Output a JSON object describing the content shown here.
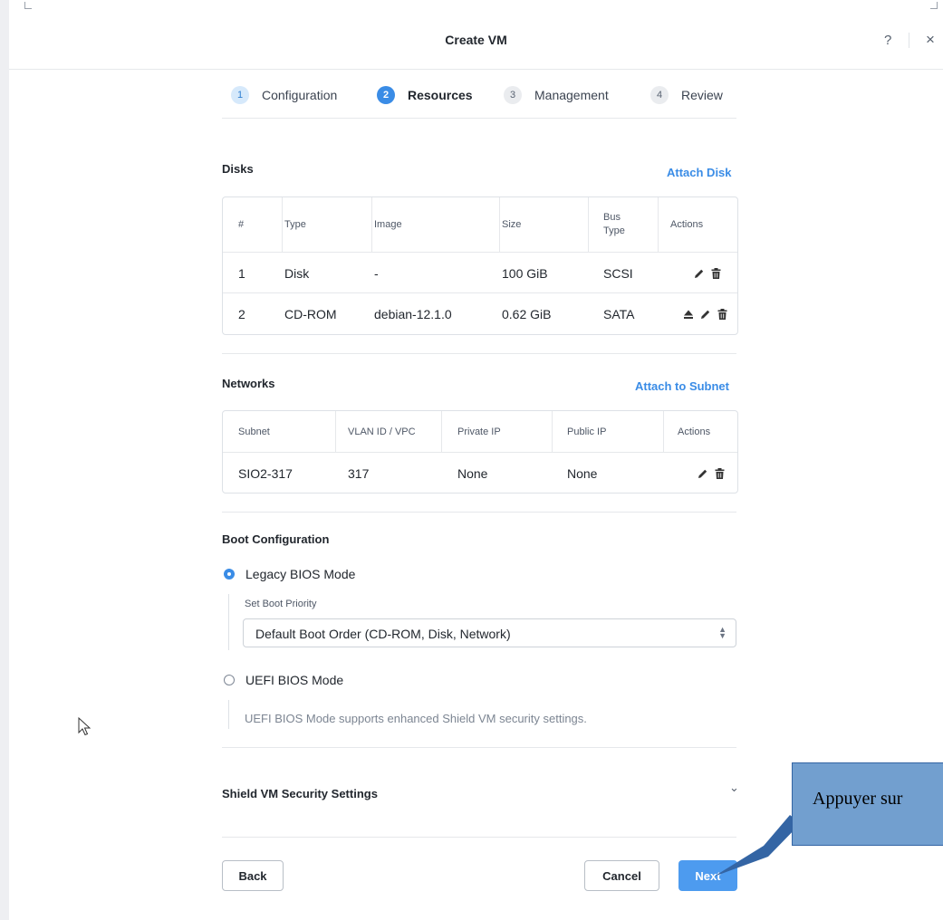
{
  "header": {
    "title": "Create VM",
    "help": "?",
    "close": "×"
  },
  "steps": [
    {
      "num": "1",
      "label": "Configuration",
      "state": "done"
    },
    {
      "num": "2",
      "label": "Resources",
      "state": "active"
    },
    {
      "num": "3",
      "label": "Management",
      "state": "pending"
    },
    {
      "num": "4",
      "label": "Review",
      "state": "pending"
    }
  ],
  "disks": {
    "title": "Disks",
    "action": "Attach Disk",
    "columns": [
      "#",
      "Type",
      "Image",
      "Size",
      "Bus\nType",
      "Actions"
    ],
    "rows": [
      {
        "num": "1",
        "type": "Disk",
        "image": "-",
        "size": "100 GiB",
        "bus": "SCSI",
        "actions": [
          "edit-icon",
          "delete-icon"
        ]
      },
      {
        "num": "2",
        "type": "CD-ROM",
        "image": "debian-12.1.0",
        "size": "0.62 GiB",
        "bus": "SATA",
        "actions": [
          "eject-icon",
          "edit-icon",
          "delete-icon"
        ]
      }
    ]
  },
  "networks": {
    "title": "Networks",
    "action": "Attach to Subnet",
    "columns": [
      "Subnet",
      "VLAN ID / VPC",
      "Private IP",
      "Public IP",
      "Actions"
    ],
    "rows": [
      {
        "subnet": "SIO2-317",
        "vlan": "317",
        "private_ip": "None",
        "public_ip": "None",
        "actions": [
          "edit-icon",
          "delete-icon"
        ]
      }
    ]
  },
  "boot": {
    "title": "Boot Configuration",
    "legacy_label": "Legacy BIOS Mode",
    "legacy_selected": true,
    "priority_label": "Set Boot Priority",
    "priority_value": "Default Boot Order (CD-ROM, Disk, Network)",
    "uefi_label": "UEFI BIOS Mode",
    "uefi_selected": false,
    "uefi_hint": "UEFI BIOS Mode supports enhanced Shield VM security settings."
  },
  "shield": {
    "title": "Shield VM Security Settings"
  },
  "footer": {
    "back": "Back",
    "cancel": "Cancel",
    "next": "Next"
  },
  "callout": {
    "text": "Appuyer sur"
  },
  "colors": {
    "accent": "#3a8ce6",
    "primary_button": "#4d9bef",
    "callout_fill": "#729fcf",
    "callout_border": "#3465a4"
  }
}
